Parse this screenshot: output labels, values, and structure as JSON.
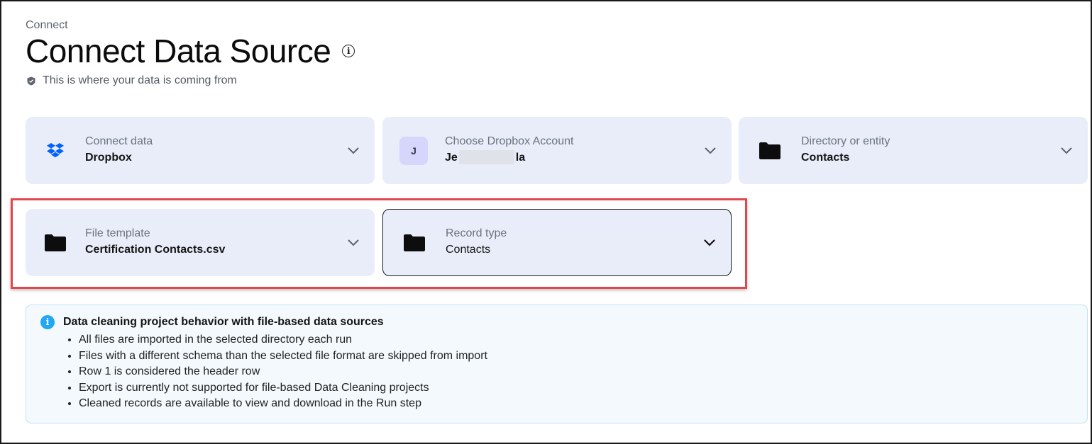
{
  "header": {
    "breadcrumb": "Connect",
    "title": "Connect Data Source",
    "subtitle": "This is where your data is coming from"
  },
  "cards": [
    {
      "label": "Connect data",
      "value": "Dropbox",
      "icon": "dropbox-icon"
    },
    {
      "label": "Choose Dropbox Account",
      "value_start": "Je",
      "value_end": "la",
      "avatar_letter": "J",
      "icon": "avatar"
    },
    {
      "label": "Directory or entity",
      "value": "Contacts",
      "icon": "folder-icon"
    },
    {
      "label": "File template",
      "value": "Certification Contacts.csv",
      "icon": "folder-icon"
    },
    {
      "label": "Record type",
      "value": "Contacts",
      "icon": "folder-icon"
    }
  ],
  "notice": {
    "title": "Data cleaning project behavior with file-based data sources",
    "items": [
      "All files are imported in the selected directory each run",
      "Files with a different schema than the selected file format are skipped from import",
      "Row 1 is considered the header row",
      "Export is currently not supported for file-based Data Cleaning projects",
      "Cleaned records are available to view and download in the Run step"
    ]
  },
  "colors": {
    "card_bg": "#e8edf9",
    "highlight": "#e0484d",
    "info_accent": "#21a7f3",
    "dropbox": "#0061fe",
    "avatar_bg": "#d6d5fb"
  }
}
